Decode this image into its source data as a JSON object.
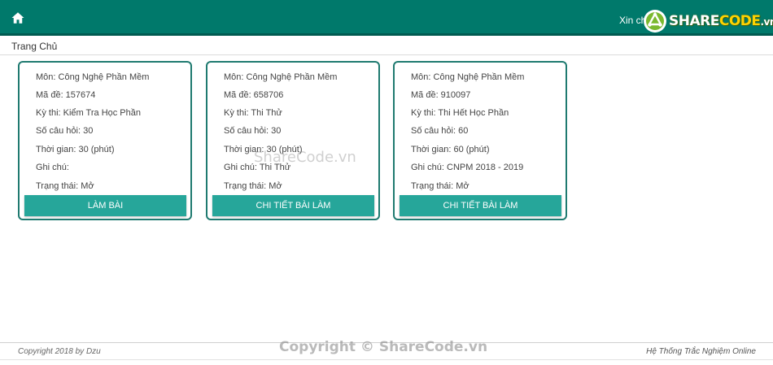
{
  "header": {
    "home_icon": "home-icon",
    "greeting": "Xin ch",
    "logo": {
      "part1": "SHARE",
      "part2": "CODE",
      "part3": ".vn"
    }
  },
  "breadcrumb": {
    "label": "Trang Chủ"
  },
  "cards": [
    {
      "mon": "Môn: Công Nghệ Phần Mềm",
      "ma_de": "Mã đề: 157674",
      "ky_thi": "Kỳ thi: Kiểm Tra Học Phần",
      "so_cau": "Số câu hỏi: 30",
      "thoi_gian": "Thời gian: 30 (phút)",
      "ghi_chu": "Ghi chú:",
      "trang_thai": "Trạng thái: Mở",
      "button": "LÀM BÀI"
    },
    {
      "mon": "Môn: Công Nghệ Phần Mềm",
      "ma_de": "Mã đề: 658706",
      "ky_thi": "Kỳ thi: Thi Thử",
      "so_cau": "Số câu hỏi: 30",
      "thoi_gian": "Thời gian: 30 (phút)",
      "ghi_chu": "Ghi chú: Thi Thử",
      "trang_thai": "Trạng thái: Mở",
      "button": "CHI TIẾT BÀI LÀM"
    },
    {
      "mon": "Môn: Công Nghệ Phần Mềm",
      "ma_de": "Mã đề: 910097",
      "ky_thi": "Kỳ thi: Thi Hết Học Phần",
      "so_cau": "Số câu hỏi: 60",
      "thoi_gian": "Thời gian: 60 (phút)",
      "ghi_chu": "Ghi chú: CNPM 2018 - 2019",
      "trang_thai": "Trạng thái: Mở",
      "button": "CHI TIẾT BÀI LÀM"
    }
  ],
  "watermark": "ShareCode.vn",
  "footer": {
    "left": "Copyright 2018 by Dzu",
    "center": "Copyright © ShareCode.vn",
    "right": "Hệ Thống Trắc Nghiệm Online"
  },
  "colors": {
    "header": "#00796b",
    "button": "#26a69a",
    "card_border": "#1f7a70"
  }
}
